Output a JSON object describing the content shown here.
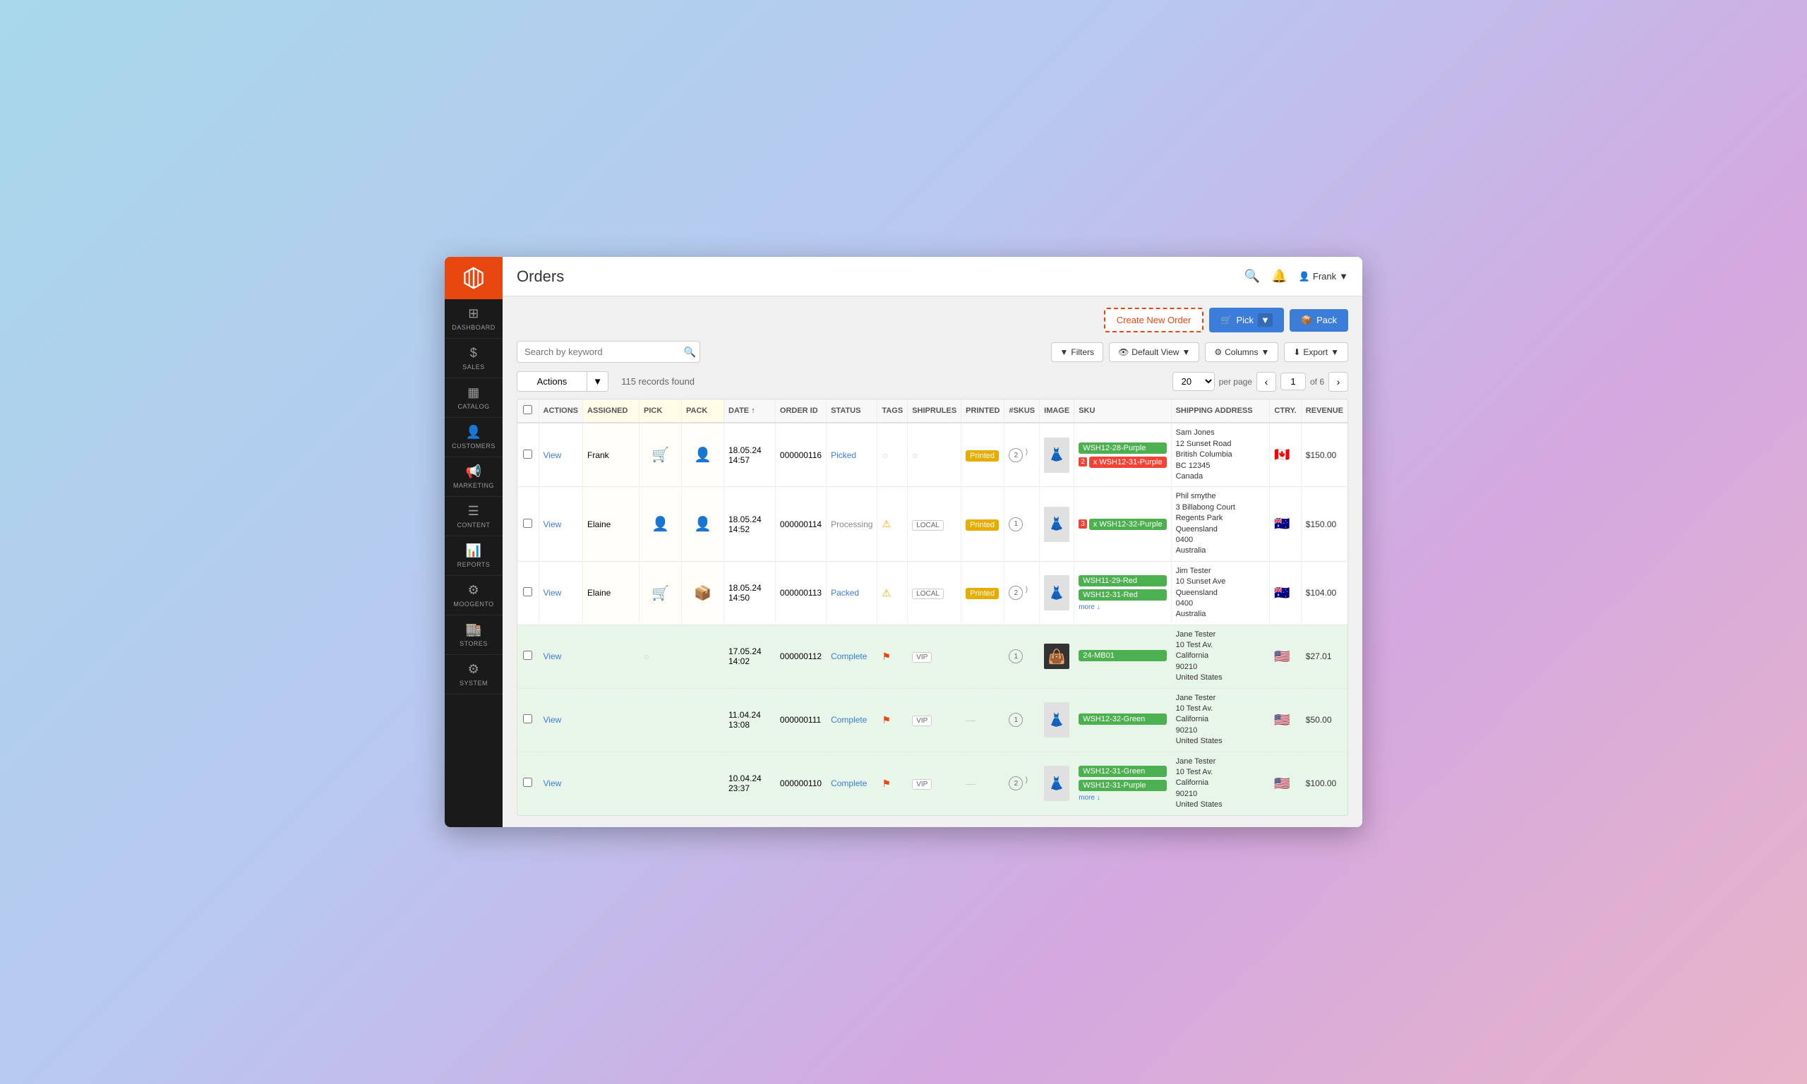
{
  "window": {
    "title": "Orders"
  },
  "sidebar": {
    "logo": "M",
    "items": [
      {
        "label": "Dashboard",
        "icon": "⊞"
      },
      {
        "label": "Sales",
        "icon": "$"
      },
      {
        "label": "Catalog",
        "icon": "▦"
      },
      {
        "label": "Customers",
        "icon": "👤"
      },
      {
        "label": "Marketing",
        "icon": "📢"
      },
      {
        "label": "Content",
        "icon": "☰"
      },
      {
        "label": "Reports",
        "icon": "📊"
      },
      {
        "label": "Moogento",
        "icon": "⚙"
      },
      {
        "label": "Stores",
        "icon": "🏬"
      },
      {
        "label": "System",
        "icon": "⚙"
      }
    ]
  },
  "topbar": {
    "title": "Orders",
    "search_icon": "🔍",
    "bell_icon": "🔔",
    "user_name": "Frank",
    "user_arrow": "▼"
  },
  "toolbar": {
    "create_new_order": "Create New Order",
    "pick_label": "Pick",
    "pack_label": "Pack"
  },
  "search": {
    "placeholder": "Search by keyword"
  },
  "filters": {
    "filter_btn": "Filters",
    "view_btn": "Default View",
    "columns_btn": "Columns",
    "export_btn": "Export"
  },
  "records": {
    "actions_label": "Actions",
    "count": "115 records found",
    "page_size": "20",
    "per_page": "per page",
    "current_page": "1",
    "total_pages": "of 6"
  },
  "table": {
    "headers": [
      "checkbox",
      "ACTIONS",
      "ASSIGNED",
      "PICK",
      "PACK",
      "DATE",
      "ORDER ID",
      "STATUS",
      "TAGS",
      "SHIPRULES",
      "PRINTED",
      "#SKUS",
      "IMAGE",
      "SKU",
      "SHIPPING ADDRESS",
      "CTRY.",
      "REVENUE"
    ],
    "rows": [
      {
        "id": "r1",
        "row_class": "row-white",
        "view_link": "View",
        "assigned": "Frank",
        "pick": "checked",
        "pack": "empty",
        "date": "18.05.24 14:57",
        "order_id": "000000116",
        "status": "Picked",
        "status_class": "status-picked",
        "tags": "",
        "shiprules": "",
        "printed": "Printed",
        "skus": "2",
        "sku_list": [
          "WSH12-28-Purple",
          "2 x WSH12-31-Purple"
        ],
        "sku_colors": [
          "green",
          "red"
        ],
        "address_name": "Sam Jones",
        "address_lines": [
          "12 Sunset Road",
          "British Columbia",
          "BC 12345",
          "Canada"
        ],
        "country": "🇨🇦",
        "revenue": "$150.00",
        "has_more": true
      },
      {
        "id": "r2",
        "row_class": "row-white",
        "view_link": "View",
        "assigned": "Elaine",
        "pick": "user",
        "pack": "user",
        "date": "18.05.24 14:52",
        "order_id": "000000114",
        "status": "Processing",
        "status_class": "status-processing",
        "tags": "warning",
        "shiprules": "LOCAL",
        "printed": "Printed",
        "skus": "1",
        "sku_list": [
          "3 x WSH12-32-Purple"
        ],
        "sku_colors": [
          "green"
        ],
        "address_name": "Phil smythe",
        "address_lines": [
          "3 Billabong Court Regents Park",
          "Queensland",
          "0400",
          "Australia"
        ],
        "country": "🇦🇺",
        "revenue": "$150.00",
        "has_more": false
      },
      {
        "id": "r3",
        "row_class": "row-white",
        "view_link": "View",
        "assigned": "Elaine",
        "pick": "checked",
        "pack": "box",
        "date": "18.05.24 14:50",
        "order_id": "000000113",
        "status": "Packed",
        "status_class": "status-packed",
        "tags": "warning",
        "shiprules": "LOCAL",
        "printed": "Printed",
        "skus": "2",
        "sku_list": [
          "WSH11-29-Red",
          "WSH12-31-Red"
        ],
        "sku_colors": [
          "green",
          "green"
        ],
        "address_name": "Jim Tester",
        "address_lines": [
          "10 Sunset Ave",
          "Queensland",
          "0400",
          "Australia"
        ],
        "country": "🇦🇺",
        "revenue": "$104.00",
        "has_more": true
      },
      {
        "id": "r4",
        "row_class": "row-green",
        "view_link": "View",
        "assigned": "",
        "pick": "",
        "pack": "",
        "date": "17.05.24 14:02",
        "order_id": "000000112",
        "status": "Complete",
        "status_class": "status-complete",
        "tags": "flag",
        "shiprules": "VIP",
        "printed": "",
        "skus": "1",
        "sku_list": [
          "24-MB01"
        ],
        "sku_colors": [
          "green"
        ],
        "address_name": "Jane Tester",
        "address_lines": [
          "10 Test Av.",
          "California",
          "90210",
          "United States"
        ],
        "country": "🇺🇸",
        "revenue": "$27.01",
        "has_more": false,
        "image_type": "bag"
      },
      {
        "id": "r5",
        "row_class": "row-green",
        "view_link": "View",
        "assigned": "",
        "pick": "",
        "pack": "",
        "date": "11.04.24 13:08",
        "order_id": "000000111",
        "status": "Complete",
        "status_class": "status-complete",
        "tags": "flag",
        "shiprules": "VIP",
        "printed": "",
        "skus": "1",
        "sku_list": [
          "WSH12-32-Green"
        ],
        "sku_colors": [
          "green"
        ],
        "address_name": "Jane Tester",
        "address_lines": [
          "10 Test Av.",
          "California",
          "90210",
          "United States"
        ],
        "country": "🇺🇸",
        "revenue": "$50.00",
        "has_more": false
      },
      {
        "id": "r6",
        "row_class": "row-green",
        "view_link": "View",
        "assigned": "",
        "pick": "",
        "pack": "",
        "date": "10.04.24 23:37",
        "order_id": "000000110",
        "status": "Complete",
        "status_class": "status-complete",
        "tags": "flag",
        "shiprules": "VIP",
        "printed": "",
        "skus": "2",
        "sku_list": [
          "WSH12-31-Green",
          "WSH12-31-Purple"
        ],
        "sku_colors": [
          "green",
          "green"
        ],
        "address_name": "Jane Tester",
        "address_lines": [
          "10 Test Av.",
          "California",
          "90210",
          "United States"
        ],
        "country": "🇺🇸",
        "revenue": "$100.00",
        "has_more": true
      }
    ]
  }
}
